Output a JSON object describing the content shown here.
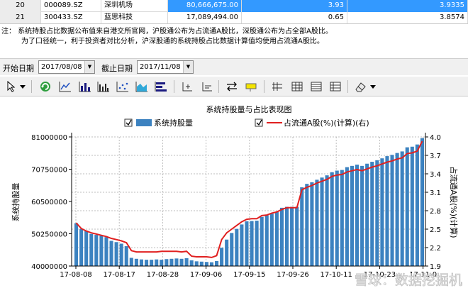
{
  "table": {
    "rows": [
      {
        "no": "20",
        "code": "000089.SZ",
        "name": "深圳机场",
        "holding": "80,666,675.00",
        "pct": "3.93",
        "ratio": "3.9335",
        "selected": true
      },
      {
        "no": "21",
        "code": "300433.SZ",
        "name": "蓝思科技",
        "holding": "17,089,494.00",
        "pct": "0.65",
        "ratio": "3.8574",
        "selected": false
      }
    ]
  },
  "note": {
    "line1": "注：  系统持股占比数据公布值来自港交所官网，沪股通公布为占流通A股比，深股通公布为占全部A股比。",
    "line2": "为了口径统一，利于投资者对比分析，沪深股通的系统持股占比数据计算值均使用占流通A股比。"
  },
  "filters": {
    "start_label": "开始日期",
    "start_value": "2017/08/08",
    "end_label": "截止日期",
    "end_value": "2017/11/08"
  },
  "toolbar": {
    "icons": [
      "pointer-icon",
      "dropdown-arrow-icon",
      "refresh-icon",
      "line-chart-icon",
      "bar-chart-icon",
      "column-chart-icon",
      "scatter-chart-icon",
      "area-chart-icon",
      "horizontal-bar-icon",
      "axis-icon",
      "axis-scale-icon",
      "swap-icon",
      "annotation-icon",
      "number-format-icon",
      "grid-icon",
      "table-icon",
      "list-icon",
      "eraser-icon",
      "dropdown-arrow-icon"
    ]
  },
  "chart_data": {
    "type": "bar",
    "title": "系统持股量与占比表现图",
    "legend": [
      {
        "label": "系统持股量",
        "type": "bar",
        "color": "#3c82c0",
        "checked": true
      },
      {
        "label": "占流通A股(%)(计算)(右)",
        "type": "line",
        "color": "#e02020",
        "checked": true
      }
    ],
    "ylabel_left": "系统持股量",
    "ylabel_right": "占流通A股(%)(计算)",
    "ylim_left": [
      40000000,
      81000000
    ],
    "ylim_right": [
      1.9,
      4.0
    ],
    "yticks_left": [
      "81000000",
      "70750000",
      "60500000",
      "50250000",
      "40000000"
    ],
    "yticks_right": [
      "4.0",
      "3.7",
      "3.4",
      "3.1",
      "2.8",
      "2.5",
      "2.2",
      "1.9"
    ],
    "x_tick_labels": [
      "17-08-08",
      "17-08-17",
      "17-08-28",
      "17-09-06",
      "17-09-15",
      "17-09-26",
      "17-10-11",
      "17-10-23",
      "17-11-0"
    ],
    "bar_values": [
      53600000,
      51800000,
      51200000,
      50200000,
      49900000,
      49600000,
      49200000,
      48000000,
      47600000,
      47100000,
      46300000,
      42600000,
      42300000,
      42100000,
      42000000,
      42000000,
      42100000,
      42000000,
      42200000,
      42300000,
      42400000,
      42300000,
      42500000,
      41800000,
      41500000,
      41400000,
      41300000,
      41200000,
      41600000,
      45800000,
      48400000,
      50500000,
      51800000,
      53200000,
      54200000,
      54300000,
      54400000,
      55600000,
      56100000,
      56600000,
      57200000,
      58500000,
      58800000,
      58800000,
      58800000,
      65000000,
      66100000,
      66600000,
      67400000,
      68100000,
      68800000,
      69800000,
      70300000,
      70500000,
      71400000,
      71800000,
      72200000,
      71800000,
      72500000,
      73100000,
      73600000,
      74200000,
      74900000,
      75300000,
      75900000,
      76400000,
      77700000,
      77900000,
      78600000,
      80600000
    ],
    "line_values": [
      2.6,
      2.51,
      2.47,
      2.44,
      2.42,
      2.4,
      2.38,
      2.35,
      2.33,
      2.31,
      2.28,
      2.15,
      2.13,
      2.13,
      2.13,
      2.13,
      2.13,
      2.14,
      2.14,
      2.14,
      2.14,
      2.13,
      2.14,
      2.06,
      2.05,
      2.05,
      2.05,
      2.04,
      2.07,
      2.33,
      2.44,
      2.5,
      2.56,
      2.62,
      2.66,
      2.67,
      2.67,
      2.72,
      2.73,
      2.76,
      2.78,
      2.82,
      2.85,
      2.85,
      2.85,
      3.14,
      3.18,
      3.21,
      3.25,
      3.28,
      3.31,
      3.36,
      3.38,
      3.39,
      3.43,
      3.45,
      3.47,
      3.45,
      3.48,
      3.51,
      3.53,
      3.56,
      3.59,
      3.61,
      3.64,
      3.66,
      3.73,
      3.74,
      3.77,
      3.93
    ],
    "grid": true
  },
  "watermark": "雪球：数据挖掘机"
}
